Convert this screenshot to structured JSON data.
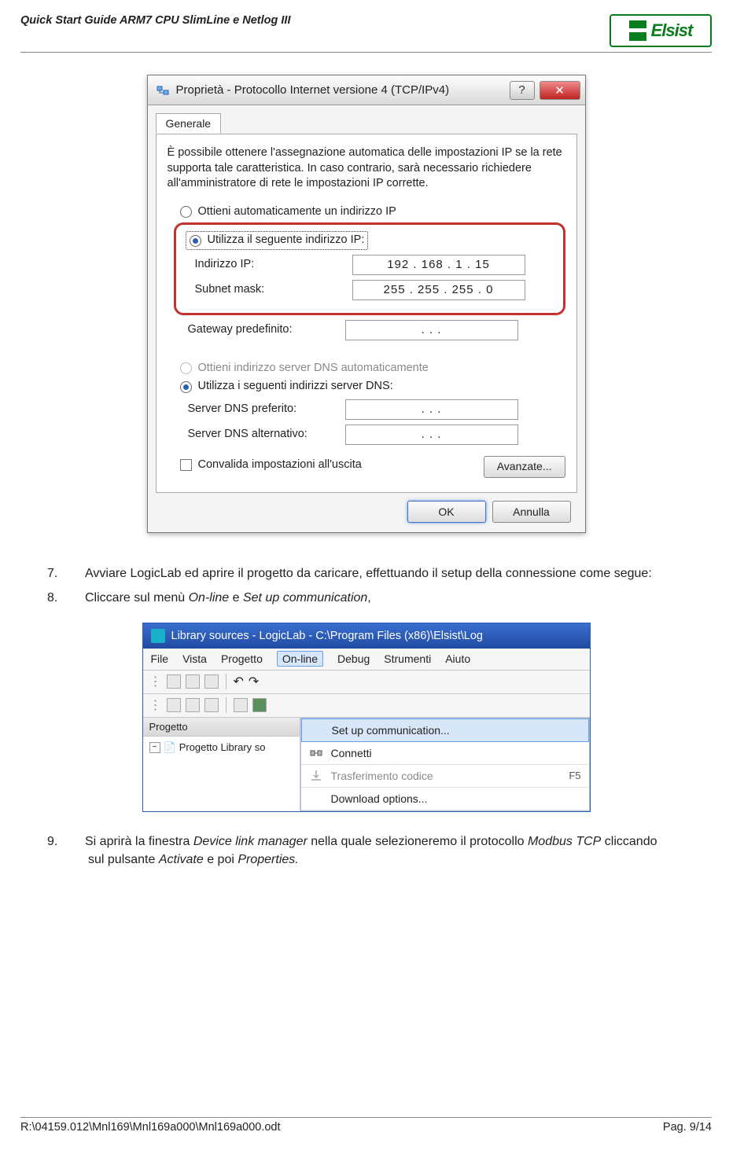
{
  "header": {
    "title": "Quick Start Guide ARM7 CPU SlimLine e Netlog III",
    "logo": "Elsist"
  },
  "dialog": {
    "title": "Proprietà - Protocollo Internet versione 4 (TCP/IPv4)",
    "tab": "Generale",
    "description": "È possibile ottenere l'assegnazione automatica delle impostazioni IP se la rete supporta tale caratteristica. In caso contrario, sarà necessario richiedere all'amministratore di rete le impostazioni IP corrette.",
    "radio_auto_ip": "Ottieni automaticamente un indirizzo IP",
    "radio_manual_ip": "Utilizza il seguente indirizzo IP:",
    "ip_label": "Indirizzo IP:",
    "ip_value": "192 . 168 .   1  .  15",
    "mask_label": "Subnet mask:",
    "mask_value": "255 . 255 . 255 .   0",
    "gw_label": "Gateway predefinito:",
    "gw_value": ".        .        .",
    "radio_auto_dns": "Ottieni indirizzo server DNS automaticamente",
    "radio_manual_dns": "Utilizza i seguenti indirizzi server DNS:",
    "dns1_label": "Server DNS preferito:",
    "dns1_value": ".        .        .",
    "dns2_label": "Server DNS alternativo:",
    "dns2_value": ".        .        .",
    "validate": "Convalida impostazioni all'uscita",
    "advanced": "Avanzate...",
    "ok": "OK",
    "cancel": "Annulla"
  },
  "text": {
    "p7": "Avviare LogicLab ed aprire il progetto da caricare, effettuando il setup della connessione come segue:",
    "p8_a": "Cliccare sul menù ",
    "p8_b": "On-line",
    "p8_c": " e ",
    "p8_d": "Set up communication",
    "p8_e": ",",
    "p9_a": "Si aprirà la finestra ",
    "p9_b": "Device link manager",
    "p9_c": " nella quale selezioneremo il protocollo ",
    "p9_d": "Modbus TCP",
    "p9_e": " cliccando sul pulsante ",
    "p9_f": "Activate",
    "p9_g": " e poi ",
    "p9_h": "Properties.",
    "n7": "7.",
    "n8": "8.",
    "n9": "9."
  },
  "ide": {
    "title": "Library sources - LogicLab - C:\\Program Files (x86)\\Elsist\\Log",
    "menu": [
      "File",
      "Vista",
      "Progetto",
      "On-line",
      "Debug",
      "Strumenti",
      "Aiuto"
    ],
    "project_pane": "Progetto",
    "tree_item": "Progetto Library so",
    "dd_setup": "Set up communication...",
    "dd_connect": "Connetti",
    "dd_transfer": "Trasferimento codice",
    "dd_transfer_key": "F5",
    "dd_download": "Download options..."
  },
  "footer": {
    "path": "R:\\04159.012\\Mnl169\\Mnl169a000\\Mnl169a000.odt",
    "page": "Pag. 9/14"
  }
}
